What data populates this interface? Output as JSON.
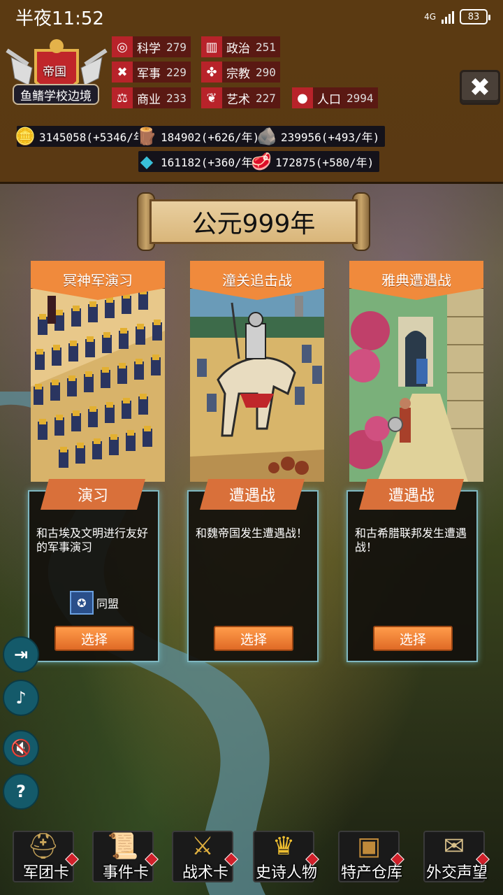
{
  "status": {
    "time": "半夜11:52",
    "network": "4G",
    "battery": "83"
  },
  "nation": {
    "emblem_title": "帝国",
    "name": "鱼鳍学校边境"
  },
  "stats": [
    {
      "icon": "science-icon",
      "glyph": "◎",
      "label": "科学",
      "value": "279"
    },
    {
      "icon": "politics-icon",
      "glyph": "▥",
      "label": "政治",
      "value": "251"
    },
    {
      "icon": "military-icon",
      "glyph": "✖",
      "label": "军事",
      "value": "229"
    },
    {
      "icon": "religion-icon",
      "glyph": "✤",
      "label": "宗教",
      "value": "290"
    },
    {
      "icon": "commerce-icon",
      "glyph": "⚖",
      "label": "商业",
      "value": "233"
    },
    {
      "icon": "art-icon",
      "glyph": "❦",
      "label": "艺术",
      "value": "227"
    },
    {
      "icon": "population-icon",
      "glyph": "●",
      "label": "人口",
      "value": "2994"
    }
  ],
  "resources": [
    {
      "icon": "gold-icon",
      "glyph": "🪙",
      "value": "3145058(+5346/年"
    },
    {
      "icon": "wood-icon",
      "glyph": "🪵",
      "value": "184902(+626/年)"
    },
    {
      "icon": "stone-icon",
      "glyph": "🪨",
      "value": "239956(+493/年)"
    },
    {
      "icon": "tech-crystal-icon",
      "glyph": "◆",
      "value": "161182(+360/年)"
    },
    {
      "icon": "meat-icon",
      "glyph": "🥩",
      "value": "172875(+580/年)"
    }
  ],
  "year_banner": "公元999年",
  "cards": [
    {
      "title": "冥神军演习",
      "type": "演习",
      "description": "和古埃及文明进行友好的军事演习",
      "ally": "同盟",
      "choose": "选择"
    },
    {
      "title": "潼关追击战",
      "type": "遭遇战",
      "description": "和魏帝国发生遭遇战！",
      "ally": "",
      "choose": "选择"
    },
    {
      "title": "雅典遭遇战",
      "type": "遭遇战",
      "description": "和古希腊联邦发生遭遇战！",
      "ally": "",
      "choose": "选择"
    }
  ],
  "side_buttons": [
    {
      "name": "exit-icon",
      "glyph": "⇥"
    },
    {
      "name": "music-off-icon",
      "glyph": "♪"
    },
    {
      "name": "sound-off-icon",
      "glyph": "🔇"
    },
    {
      "name": "help-icon",
      "glyph": "?"
    }
  ],
  "nav": [
    {
      "icon": "helmet-icon",
      "glyph": "⛑",
      "label": "军团卡"
    },
    {
      "icon": "scroll-icon",
      "glyph": "📜",
      "label": "事件卡"
    },
    {
      "icon": "crossed-swords-icon",
      "glyph": "⚔",
      "label": "战术卡"
    },
    {
      "icon": "crown-icon",
      "glyph": "♛",
      "label": "史诗人物"
    },
    {
      "icon": "treasure-chest-icon",
      "glyph": "▣",
      "label": "特产仓库"
    },
    {
      "icon": "letter-icon",
      "glyph": "✉",
      "label": "外交声望"
    }
  ],
  "colors": {
    "header_bg": "#5b3a12",
    "card_orange": "#f08a3c",
    "button_orange": "#e06a26",
    "stat_red": "#b8232a",
    "side_button_teal": "#145a6a"
  }
}
